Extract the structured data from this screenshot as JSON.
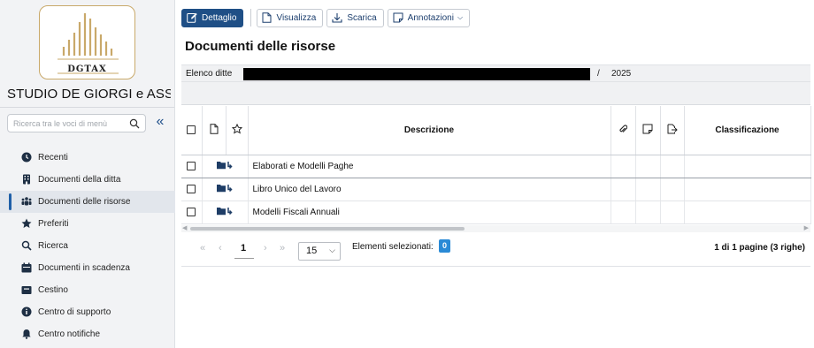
{
  "sidebar": {
    "logo_text": "DGTAX",
    "firm_name": "STUDIO DE GIORGI e ASSOC...",
    "search_placeholder": "Ricerca tra le voci di menù",
    "collapse_label": "«",
    "items": [
      {
        "label": "Recenti",
        "icon": "clock-icon"
      },
      {
        "label": "Documenti della ditta",
        "icon": "building-icon"
      },
      {
        "label": "Documenti delle risorse",
        "icon": "users-icon",
        "active": true
      },
      {
        "label": "Preferiti",
        "icon": "star-icon"
      },
      {
        "label": "Ricerca",
        "icon": "search-icon"
      },
      {
        "label": "Documenti in scadenza",
        "icon": "calendar-icon"
      },
      {
        "label": "Cestino",
        "icon": "trash-icon"
      },
      {
        "label": "Centro di supporto",
        "icon": "info-icon"
      },
      {
        "label": "Centro notifiche",
        "icon": "bell-icon"
      }
    ]
  },
  "toolbar": {
    "dettaglio": "Dettaglio",
    "visualizza": "Visualizza",
    "scarica": "Scarica",
    "annotazioni": "Annotazioni"
  },
  "page": {
    "title": "Documenti delle risorse",
    "ditte_label": "Elenco ditte",
    "slash": "/",
    "year": "2025"
  },
  "grid": {
    "columns": {
      "description": "Descrizione",
      "classification": "Classificazione"
    },
    "rows": [
      {
        "description": "Elaborati e Modelli Paghe",
        "classification": ""
      },
      {
        "description": "Libro Unico del Lavoro",
        "classification": ""
      },
      {
        "description": "Modelli Fiscali Annuali",
        "classification": ""
      }
    ]
  },
  "pager": {
    "current_page": "1",
    "page_size": "15",
    "selected_label": "Elementi selezionati:",
    "selected_count": "0",
    "info": "1 di 1 pagine (3 righe)"
  },
  "colors": {
    "primary": "#1f4f86",
    "accent": "#2a8ad6",
    "logo_gold": "#c9a96a"
  }
}
